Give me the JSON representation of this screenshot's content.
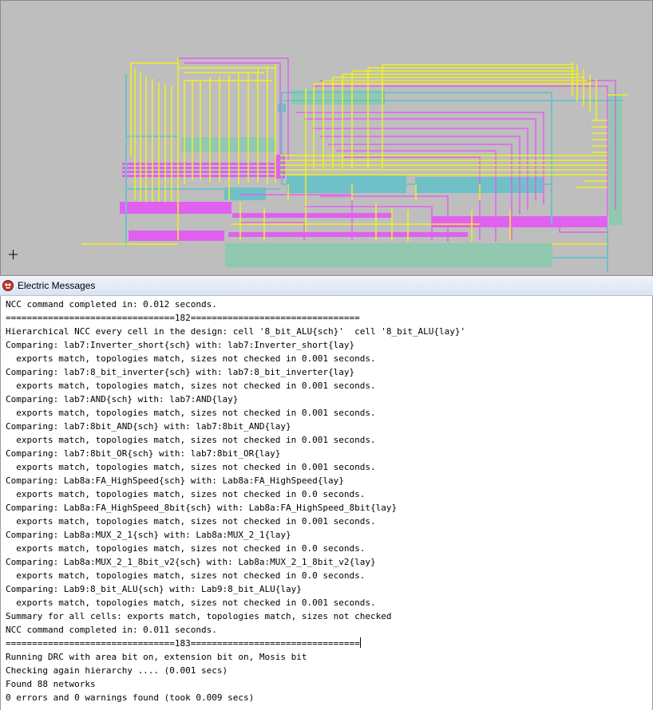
{
  "messages_window": {
    "title": "Electric Messages",
    "lines": [
      "NCC command completed in: 0.012 seconds.",
      "================================182================================",
      "Hierarchical NCC every cell in the design: cell '8_bit_ALU{sch}'  cell '8_bit_ALU{lay}'",
      "Comparing: lab7:Inverter_short{sch} with: lab7:Inverter_short{lay}",
      "  exports match, topologies match, sizes not checked in 0.001 seconds.",
      "Comparing: lab7:8_bit_inverter{sch} with: lab7:8_bit_inverter{lay}",
      "  exports match, topologies match, sizes not checked in 0.001 seconds.",
      "Comparing: lab7:AND{sch} with: lab7:AND{lay}",
      "  exports match, topologies match, sizes not checked in 0.001 seconds.",
      "Comparing: lab7:8bit_AND{sch} with: lab7:8bit_AND{lay}",
      "  exports match, topologies match, sizes not checked in 0.001 seconds.",
      "Comparing: lab7:8bit_OR{sch} with: lab7:8bit_OR{lay}",
      "  exports match, topologies match, sizes not checked in 0.001 seconds.",
      "Comparing: Lab8a:FA_HighSpeed{sch} with: Lab8a:FA_HighSpeed{lay}",
      "  exports match, topologies match, sizes not checked in 0.0 seconds.",
      "Comparing: Lab8a:FA_HighSpeed_8bit{sch} with: Lab8a:FA_HighSpeed_8bit{lay}",
      "  exports match, topologies match, sizes not checked in 0.001 seconds.",
      "Comparing: Lab8a:MUX_2_1{sch} with: Lab8a:MUX_2_1{lay}",
      "  exports match, topologies match, sizes not checked in 0.0 seconds.",
      "Comparing: Lab8a:MUX_2_1_8bit_v2{sch} with: Lab8a:MUX_2_1_8bit_v2{lay}",
      "  exports match, topologies match, sizes not checked in 0.0 seconds.",
      "Comparing: Lab9:8_bit_ALU{sch} with: Lab9:8_bit_ALU{lay}",
      "  exports match, topologies match, sizes not checked in 0.001 seconds.",
      "Summary for all cells: exports match, topologies match, sizes not checked",
      "NCC command completed in: 0.011 seconds.",
      "================================183================================",
      "Running DRC with area bit on, extension bit on, Mosis bit",
      "Checking again hierarchy .... (0.001 secs)",
      "Found 88 networks",
      "0 errors and 0 warnings found (took 0.009 secs)"
    ]
  },
  "layout_canvas": {
    "background": "#bebebe",
    "layer_colors": {
      "metal1": "#70c0c8",
      "metal2": "#e060f0",
      "polysilicon": "#f0f020",
      "diffusion": "#90c8b0"
    },
    "cursor_icon": "crosshair-icon"
  }
}
